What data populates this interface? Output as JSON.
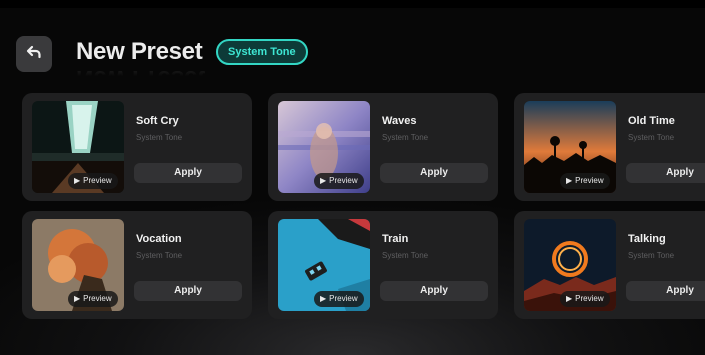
{
  "header": {
    "title": "New Preset",
    "badge": "System Tone"
  },
  "icons": {
    "back": "back-arrow-icon",
    "play": "play-icon"
  },
  "colors": {
    "accent": "#33d6c4",
    "card_bg": "#202021",
    "button_bg": "#323234"
  },
  "presets": [
    {
      "title": "Soft Cry",
      "subtitle": "System Tone",
      "preview_label": "Preview",
      "apply_label": "Apply"
    },
    {
      "title": "Waves",
      "subtitle": "System Tone",
      "preview_label": "Preview",
      "apply_label": "Apply"
    },
    {
      "title": "Old Time",
      "subtitle": "System Tone",
      "preview_label": "Preview",
      "apply_label": "Apply"
    },
    {
      "title": "Vocation",
      "subtitle": "System Tone",
      "preview_label": "Preview",
      "apply_label": "Apply"
    },
    {
      "title": "Train",
      "subtitle": "System Tone",
      "preview_label": "Preview",
      "apply_label": "Apply"
    },
    {
      "title": "Talking",
      "subtitle": "System Tone",
      "preview_label": "Preview",
      "apply_label": "Apply"
    }
  ]
}
